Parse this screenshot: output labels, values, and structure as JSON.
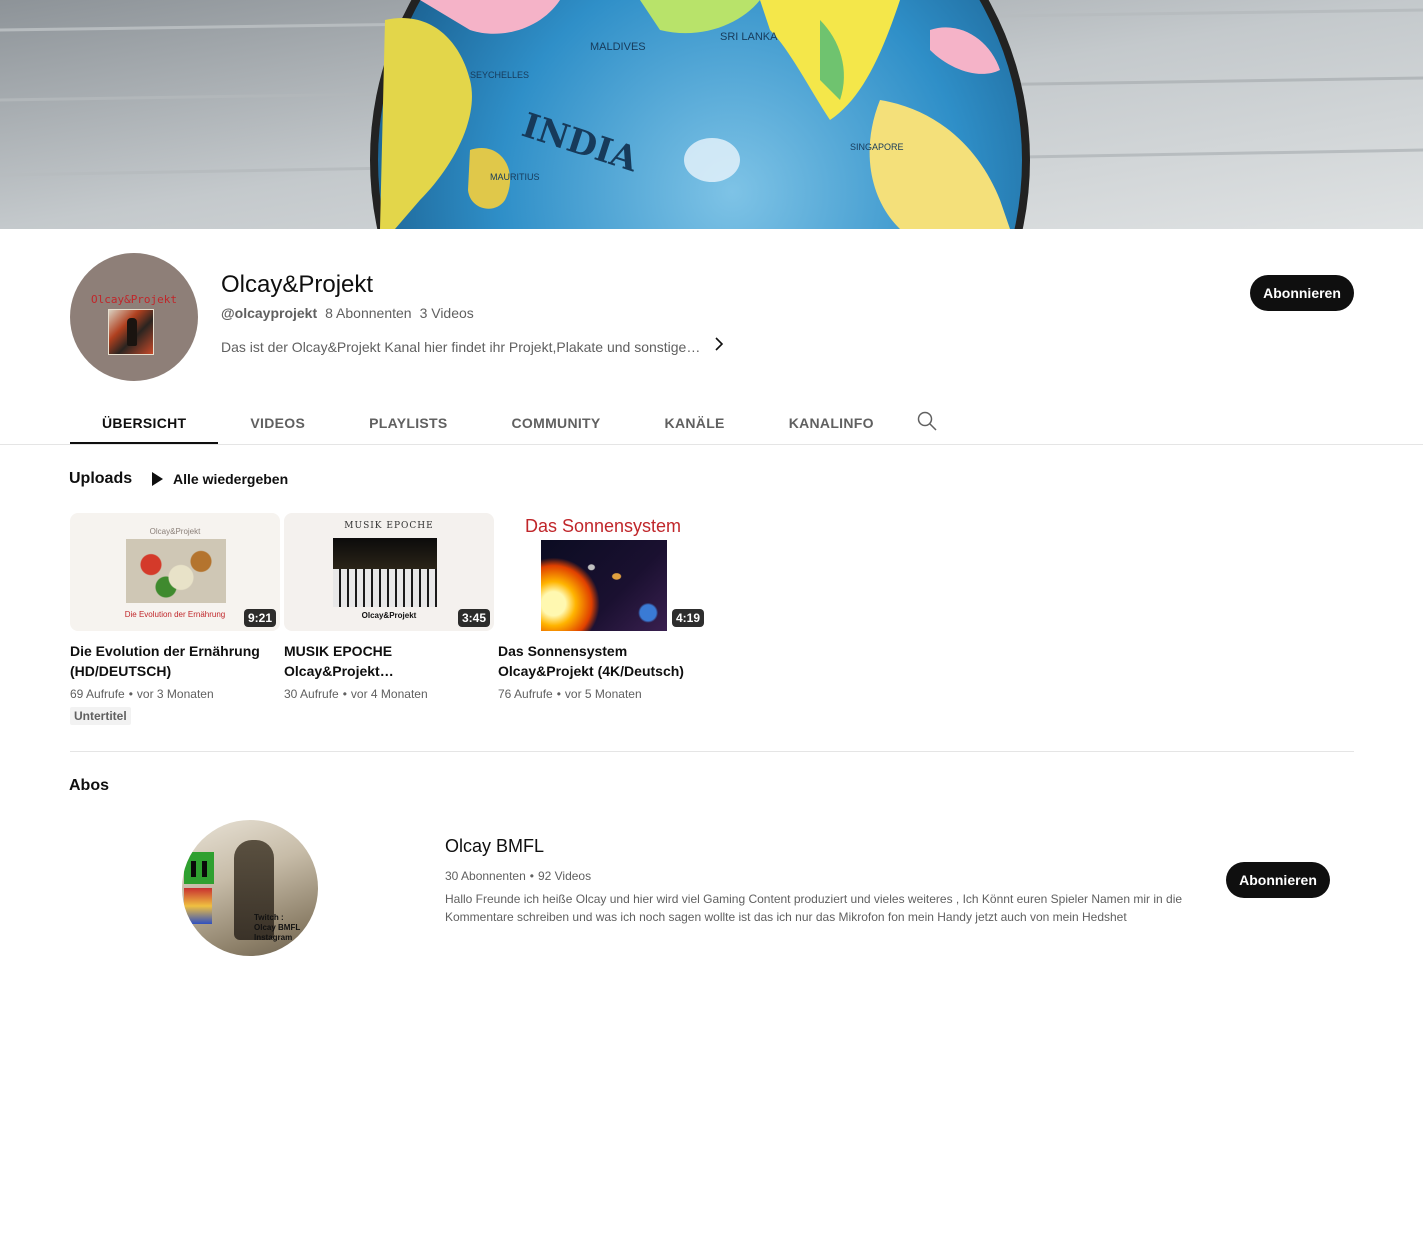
{
  "channel": {
    "avatar_text": "Olcay&Projekt",
    "title": "Olcay&Projekt",
    "handle": "@olcayprojekt",
    "subscribers": "8 Abonnenten",
    "videos_count": "3 Videos",
    "description": "Das ist der Olcay&Projekt Kanal hier findet ihr Projekt,Plakate und sonstige…",
    "subscribe_label": "Abonnieren"
  },
  "tabs": [
    {
      "label": "ÜBERSICHT",
      "active": true
    },
    {
      "label": "VIDEOS",
      "active": false
    },
    {
      "label": "PLAYLISTS",
      "active": false
    },
    {
      "label": "COMMUNITY",
      "active": false
    },
    {
      "label": "KANÄLE",
      "active": false
    },
    {
      "label": "KANALINFO",
      "active": false
    }
  ],
  "uploads": {
    "title": "Uploads",
    "play_all": "Alle wiedergeben",
    "videos": [
      {
        "title": "Die Evolution der Ernährung (HD/DEUTSCH)",
        "views": "69 Aufrufe",
        "age": "vor 3 Monaten",
        "duration": "9:21",
        "badge": "Untertitel",
        "thumb_brand": "Olcay&Projekt",
        "thumb_caption": "Die Evolution der Ernährung"
      },
      {
        "title": "MUSIK EPOCHE Olcay&Projekt…",
        "views": "30 Aufrufe",
        "age": "vor 4 Monaten",
        "duration": "3:45",
        "thumb_brand": "MUSIK EPOCHE",
        "thumb_caption": "Olcay&Projekt"
      },
      {
        "title": "Das Sonnensystem Olcay&Projekt (4K/Deutsch)",
        "views": "76 Aufrufe",
        "age": "vor 5 Monaten",
        "duration": "4:19",
        "thumb_brand": "Das Sonnensystem"
      }
    ]
  },
  "abos": {
    "title": "Abos",
    "channel": {
      "name": "Olcay BMFL",
      "subscribers": "30 Abonnenten",
      "videos": "92 Videos",
      "description": "Hallo Freunde ich heiße Olcay und hier wird viel Gaming Content produziert und vieles weiteres , Ich Könnt euren Spieler Namen mir in die Kommentare schreiben und was ich noch sagen wollte ist das ich nur das Mikrofon fon mein Handy jetzt auch von mein Hedshet",
      "avatar_text": "Twitch : Olcay BMFL Instagram",
      "subscribe_label": "Abonnieren"
    }
  },
  "icons": {
    "search": "search-icon",
    "chevron": "chevron-right-icon",
    "play": "play-icon"
  }
}
